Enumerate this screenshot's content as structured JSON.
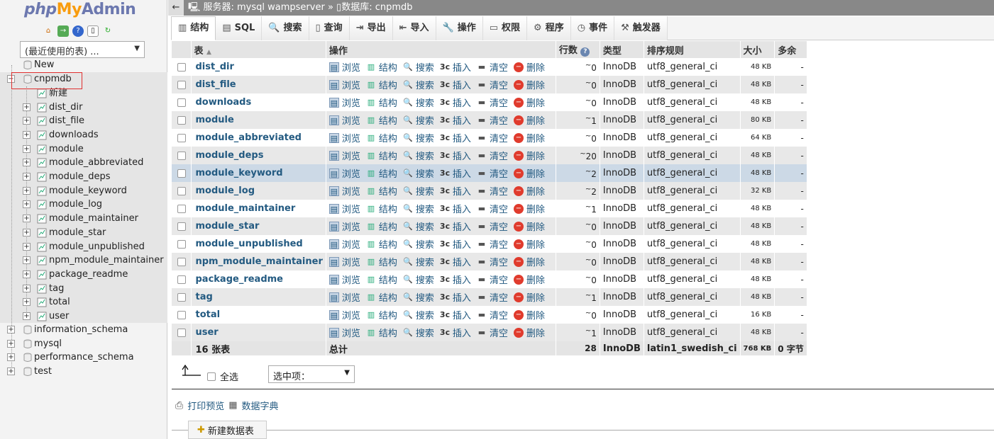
{
  "logo": {
    "php": "php",
    "my": "My",
    "admin": "Admin"
  },
  "sidebar": {
    "recent_select": "(最近使用的表) ...",
    "new_label": "New",
    "current_db": "cnpmdb",
    "new_table_label": "新建",
    "tables": [
      "dist_dir",
      "dist_file",
      "downloads",
      "module",
      "module_abbreviated",
      "module_deps",
      "module_keyword",
      "module_log",
      "module_maintainer",
      "module_star",
      "module_unpublished",
      "npm_module_maintainer",
      "package_readme",
      "tag",
      "total",
      "user"
    ],
    "other_dbs": [
      "information_schema",
      "mysql",
      "performance_schema",
      "test"
    ]
  },
  "topbar": {
    "back": "←",
    "server": "服务器: mysql wampserver",
    "sep": "»",
    "db": "数据库: cnpmdb"
  },
  "tabs": [
    {
      "label": "结构",
      "icon": "structure-icon"
    },
    {
      "label": "SQL",
      "icon": "sql-icon"
    },
    {
      "label": "搜索",
      "icon": "search-icon"
    },
    {
      "label": "查询",
      "icon": "query-icon"
    },
    {
      "label": "导出",
      "icon": "export-icon"
    },
    {
      "label": "导入",
      "icon": "import-icon"
    },
    {
      "label": "操作",
      "icon": "operations-icon"
    },
    {
      "label": "权限",
      "icon": "privileges-icon"
    },
    {
      "label": "程序",
      "icon": "routines-icon"
    },
    {
      "label": "事件",
      "icon": "events-icon"
    },
    {
      "label": "触发器",
      "icon": "triggers-icon"
    }
  ],
  "table": {
    "headers": {
      "table": "表",
      "sort": "▲",
      "actions": "操作",
      "rows": "行数",
      "type": "类型",
      "collation": "排序规则",
      "size": "大小",
      "overhead": "多余"
    },
    "actions": {
      "browse": "浏览",
      "structure": "结构",
      "search": "搜索",
      "insert": "插入",
      "empty": "清空",
      "drop": "删除"
    },
    "rows": [
      {
        "name": "dist_dir",
        "rows": "0",
        "type": "InnoDB",
        "collation": "utf8_general_ci",
        "size": "48 KB",
        "overhead": "-"
      },
      {
        "name": "dist_file",
        "rows": "0",
        "type": "InnoDB",
        "collation": "utf8_general_ci",
        "size": "48 KB",
        "overhead": "-"
      },
      {
        "name": "downloads",
        "rows": "0",
        "type": "InnoDB",
        "collation": "utf8_general_ci",
        "size": "48 KB",
        "overhead": "-"
      },
      {
        "name": "module",
        "rows": "1",
        "type": "InnoDB",
        "collation": "utf8_general_ci",
        "size": "80 KB",
        "overhead": "-"
      },
      {
        "name": "module_abbreviated",
        "rows": "0",
        "type": "InnoDB",
        "collation": "utf8_general_ci",
        "size": "64 KB",
        "overhead": "-"
      },
      {
        "name": "module_deps",
        "rows": "20",
        "type": "InnoDB",
        "collation": "utf8_general_ci",
        "size": "48 KB",
        "overhead": "-"
      },
      {
        "name": "module_keyword",
        "rows": "2",
        "type": "InnoDB",
        "collation": "utf8_general_ci",
        "size": "48 KB",
        "overhead": "-"
      },
      {
        "name": "module_log",
        "rows": "2",
        "type": "InnoDB",
        "collation": "utf8_general_ci",
        "size": "32 KB",
        "overhead": "-"
      },
      {
        "name": "module_maintainer",
        "rows": "1",
        "type": "InnoDB",
        "collation": "utf8_general_ci",
        "size": "48 KB",
        "overhead": "-"
      },
      {
        "name": "module_star",
        "rows": "0",
        "type": "InnoDB",
        "collation": "utf8_general_ci",
        "size": "48 KB",
        "overhead": "-"
      },
      {
        "name": "module_unpublished",
        "rows": "0",
        "type": "InnoDB",
        "collation": "utf8_general_ci",
        "size": "48 KB",
        "overhead": "-"
      },
      {
        "name": "npm_module_maintainer",
        "rows": "0",
        "type": "InnoDB",
        "collation": "utf8_general_ci",
        "size": "48 KB",
        "overhead": "-"
      },
      {
        "name": "package_readme",
        "rows": "0",
        "type": "InnoDB",
        "collation": "utf8_general_ci",
        "size": "48 KB",
        "overhead": "-"
      },
      {
        "name": "tag",
        "rows": "1",
        "type": "InnoDB",
        "collation": "utf8_general_ci",
        "size": "48 KB",
        "overhead": "-"
      },
      {
        "name": "total",
        "rows": "0",
        "type": "InnoDB",
        "collation": "utf8_general_ci",
        "size": "16 KB",
        "overhead": "-"
      },
      {
        "name": "user",
        "rows": "1",
        "type": "InnoDB",
        "collation": "utf8_general_ci",
        "size": "48 KB",
        "overhead": "-"
      }
    ],
    "approx_mark": "~",
    "footer": {
      "count": "16 张表",
      "label": "总计",
      "rows": "28",
      "type": "InnoDB",
      "collation": "latin1_swedish_ci",
      "size": "768 KB",
      "overhead": "0 字节"
    }
  },
  "bulk": {
    "check_all": "全选",
    "with_selected": "选中项："
  },
  "links": {
    "print": "打印预览",
    "dictionary": "数据字典"
  },
  "new_table_tab": "新建数据表",
  "colors": {
    "link": "#235a81",
    "topbar": "#888888",
    "highlight": "#ccd9e6"
  }
}
